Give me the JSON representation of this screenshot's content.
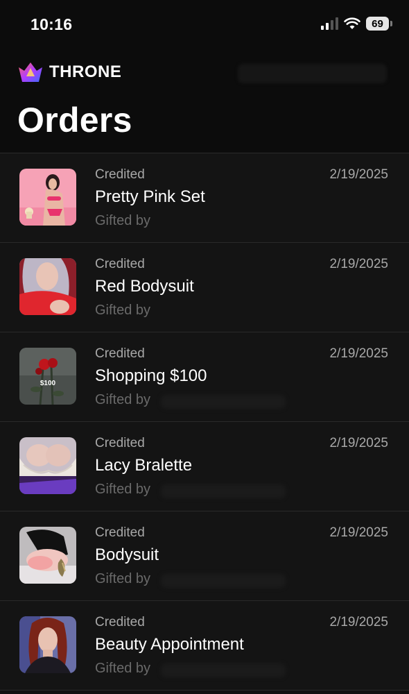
{
  "status_bar": {
    "time": "10:16",
    "battery": "69",
    "icons": [
      "cellular-signal-icon",
      "wifi-icon",
      "battery-icon"
    ]
  },
  "header": {
    "logo_text": "THRONE",
    "logo_icon": "crown-icon",
    "title": "Orders"
  },
  "colors": {
    "background": "#111111",
    "row_background": "#141414",
    "divider": "#2a2a2a",
    "muted_text": "#a8a8a8",
    "faint_text": "#6a6a6a",
    "logo_gradient": [
      "#ff6a5a",
      "#b23cff",
      "#3b6bff"
    ]
  },
  "orders": [
    {
      "status": "Credited",
      "name": "Pretty Pink Set",
      "gifted_label": "Gifted by",
      "date": "2/19/2025",
      "thumbnail": "pink-lingerie-photo"
    },
    {
      "status": "Credited",
      "name": "Red Bodysuit",
      "gifted_label": "Gifted by",
      "date": "2/19/2025",
      "thumbnail": "red-bodysuit-photo"
    },
    {
      "status": "Credited",
      "name": "Shopping $100",
      "gifted_label": "Gifted by",
      "date": "2/19/2025",
      "thumbnail": "roses-gift-card-image",
      "thumbnail_text": "$100"
    },
    {
      "status": "Credited",
      "name": "Lacy Bralette",
      "gifted_label": "Gifted by",
      "date": "2/19/2025",
      "thumbnail": "lace-bralette-photo"
    },
    {
      "status": "Credited",
      "name": "Bodysuit",
      "gifted_label": "Gifted by",
      "date": "2/19/2025",
      "thumbnail": "black-bodysuit-photo"
    },
    {
      "status": "Credited",
      "name": "Beauty Appointment",
      "gifted_label": "Gifted by",
      "date": "2/19/2025",
      "thumbnail": "beauty-portrait-photo"
    }
  ]
}
